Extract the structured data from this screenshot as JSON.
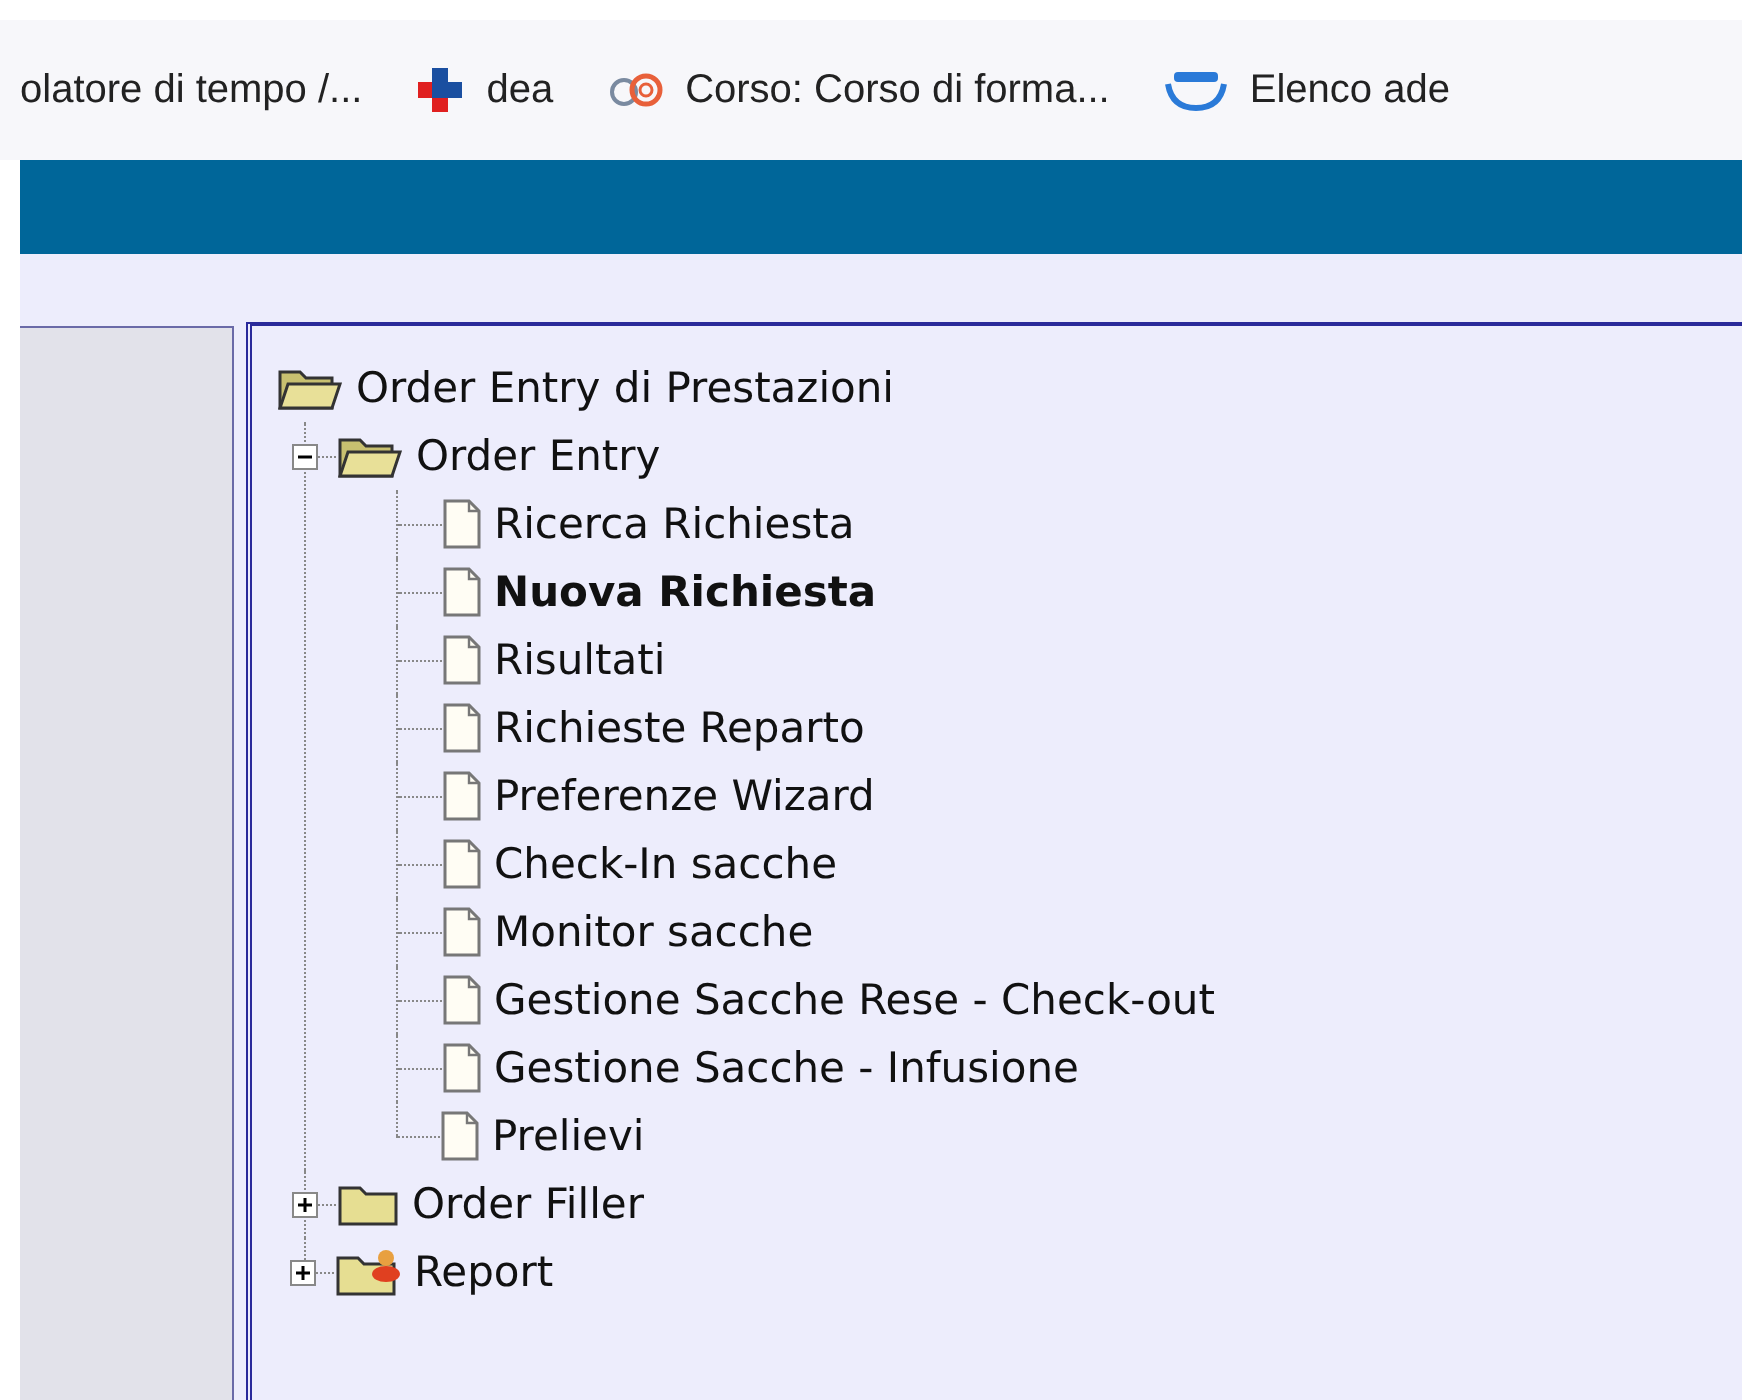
{
  "bookmarks_bar": {
    "items": [
      {
        "label": "olatore di tempo /...",
        "kind": "plain"
      },
      {
        "label": "dea",
        "kind": "cross"
      },
      {
        "label": "Corso: Corso di forma...",
        "kind": "ring"
      },
      {
        "label": "Elenco ade",
        "kind": "cloud"
      }
    ]
  },
  "tree": {
    "label": "Order Entry di Prestazioni",
    "kind": "folder",
    "expanded": true,
    "children": [
      {
        "label": "Order Entry",
        "kind": "folder",
        "expanded": true,
        "children": [
          {
            "label": "Ricerca Richiesta",
            "kind": "page",
            "selected": false
          },
          {
            "label": "Nuova Richiesta",
            "kind": "page",
            "selected": true
          },
          {
            "label": "Risultati",
            "kind": "page",
            "selected": false
          },
          {
            "label": "Richieste Reparto",
            "kind": "page",
            "selected": false
          },
          {
            "label": "Preferenze Wizard",
            "kind": "page",
            "selected": false
          },
          {
            "label": "Check-In sacche",
            "kind": "page",
            "selected": false
          },
          {
            "label": "Monitor sacche",
            "kind": "page",
            "selected": false
          },
          {
            "label": "Gestione Sacche Rese - Check-out",
            "kind": "page",
            "selected": false
          },
          {
            "label": "Gestione Sacche - Infusione",
            "kind": "page",
            "selected": false
          },
          {
            "label": "Prelievi",
            "kind": "page",
            "selected": false
          }
        ]
      },
      {
        "label": "Order Filler",
        "kind": "folder",
        "expanded": false
      },
      {
        "label": "Report",
        "kind": "report-folder",
        "expanded": false
      }
    ]
  }
}
